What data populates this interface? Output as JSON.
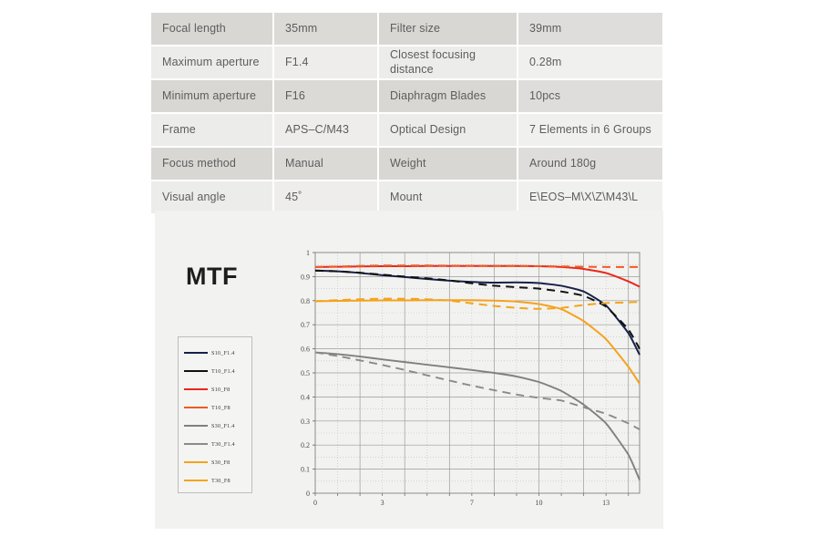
{
  "spec_table": {
    "rows": [
      {
        "shade": "dark",
        "label_a": "Focal length",
        "value_b": "35mm",
        "label_c": "Filter size",
        "value_d": "39mm"
      },
      {
        "shade": "light",
        "label_a": "Maximum aperture",
        "value_b": "F1.4",
        "label_c": "Closest\nfocusing distance",
        "value_d": "0.28m"
      },
      {
        "shade": "dark",
        "label_a": "Minimum aperture",
        "value_b": "F16",
        "label_c": "Diaphragm Blades",
        "value_d": "10pcs"
      },
      {
        "shade": "light",
        "label_a": "Frame",
        "value_b": "APS–C/M43",
        "label_c": "Optical Design",
        "value_d": "7 Elements in 6 Groups"
      },
      {
        "shade": "dark",
        "label_a": "Focus method",
        "value_b": "Manual",
        "label_c": "Weight",
        "value_d": "Around 180g"
      },
      {
        "shade": "light",
        "label_a": "Visual angle",
        "value_b": "45˚",
        "label_c": "Mount",
        "value_d": "E\\EOS–M\\X\\Z\\M43\\L"
      }
    ]
  },
  "mtf": {
    "title": "MTF",
    "legend_position": "left-inside"
  },
  "chart_data": {
    "type": "line",
    "title": "MTF",
    "xlabel": "",
    "ylabel": "",
    "xlim": [
      0,
      14.5
    ],
    "ylim": [
      0,
      1
    ],
    "xticks": [
      0,
      3,
      7,
      10,
      13
    ],
    "yticks": [
      0,
      0.1,
      0.2,
      0.3,
      0.4,
      0.5,
      0.6,
      0.7,
      0.8,
      0.9,
      1
    ],
    "grid": true,
    "legend": [
      "S10_F1.4",
      "T10_F1.4",
      "S10_F8",
      "T10_F8",
      "S30_F1.4",
      "T30_F1.4",
      "S30_F8",
      "T30_F8"
    ],
    "x": [
      0,
      1,
      2,
      3,
      4,
      5,
      6,
      7,
      8,
      9,
      10,
      11,
      12,
      13,
      14,
      14.5
    ],
    "series": [
      {
        "name": "S10_F1.4",
        "color": "#17204a",
        "dash": "solid",
        "values": [
          0.925,
          0.922,
          0.915,
          0.906,
          0.898,
          0.89,
          0.883,
          0.878,
          0.875,
          0.876,
          0.873,
          0.862,
          0.838,
          0.78,
          0.665,
          0.575
        ]
      },
      {
        "name": "T10_F1.4",
        "color": "#111111",
        "dash": "dashed",
        "values": [
          0.925,
          0.922,
          0.916,
          0.908,
          0.9,
          0.893,
          0.884,
          0.872,
          0.862,
          0.856,
          0.85,
          0.838,
          0.82,
          0.775,
          0.68,
          0.6
        ]
      },
      {
        "name": "S10_F8",
        "color": "#e8271c",
        "dash": "solid",
        "values": [
          0.94,
          0.941,
          0.942,
          0.943,
          0.943,
          0.944,
          0.944,
          0.944,
          0.944,
          0.944,
          0.943,
          0.94,
          0.932,
          0.915,
          0.88,
          0.858
        ]
      },
      {
        "name": "T10_F8",
        "color": "#f05a22",
        "dash": "dashed",
        "values": [
          0.94,
          0.942,
          0.944,
          0.946,
          0.946,
          0.946,
          0.945,
          0.945,
          0.944,
          0.944,
          0.943,
          0.942,
          0.941,
          0.94,
          0.94,
          0.94
        ]
      },
      {
        "name": "S30_F1.4",
        "color": "#808080",
        "dash": "solid",
        "values": [
          0.585,
          0.578,
          0.568,
          0.556,
          0.545,
          0.534,
          0.523,
          0.512,
          0.5,
          0.485,
          0.462,
          0.425,
          0.368,
          0.29,
          0.16,
          0.055
        ]
      },
      {
        "name": "T30_F1.4",
        "color": "#8a8a8a",
        "dash": "dashed",
        "values": [
          0.585,
          0.57,
          0.552,
          0.533,
          0.512,
          0.49,
          0.468,
          0.447,
          0.428,
          0.41,
          0.396,
          0.385,
          0.357,
          0.33,
          0.29,
          0.265
        ]
      },
      {
        "name": "S30_F8",
        "color": "#f5a21d",
        "dash": "solid",
        "values": [
          0.798,
          0.799,
          0.8,
          0.801,
          0.801,
          0.802,
          0.802,
          0.802,
          0.8,
          0.796,
          0.786,
          0.765,
          0.715,
          0.64,
          0.525,
          0.455
        ]
      },
      {
        "name": "T30_F8",
        "color": "#f3a51c",
        "dash": "dashed",
        "values": [
          0.798,
          0.802,
          0.806,
          0.808,
          0.808,
          0.806,
          0.8,
          0.789,
          0.778,
          0.77,
          0.766,
          0.77,
          0.782,
          0.79,
          0.793,
          0.795
        ]
      }
    ]
  }
}
